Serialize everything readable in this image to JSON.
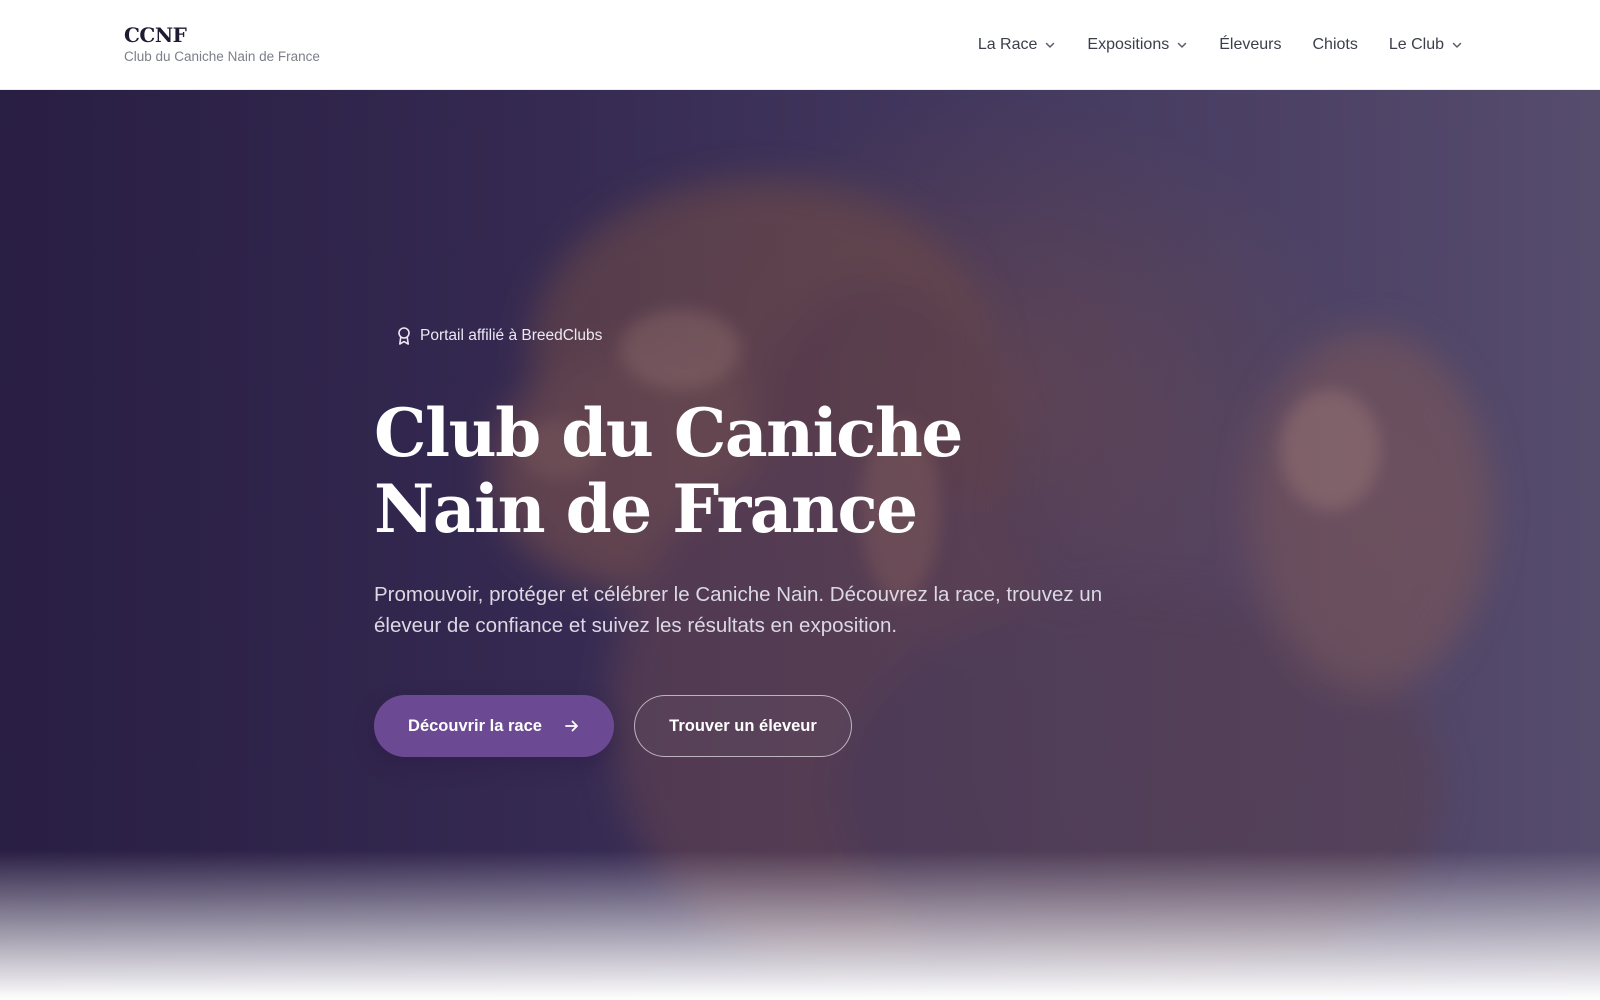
{
  "header": {
    "logo": "CCNF",
    "tagline": "Club du Caniche Nain de France",
    "nav": [
      {
        "label": "La Race",
        "has_dropdown": true
      },
      {
        "label": "Expositions",
        "has_dropdown": true
      },
      {
        "label": "Éleveurs",
        "has_dropdown": false
      },
      {
        "label": "Chiots",
        "has_dropdown": false
      },
      {
        "label": "Le Club",
        "has_dropdown": true
      }
    ]
  },
  "hero": {
    "badge_icon": "award-icon",
    "badge_text": "Portail affilié à BreedClubs",
    "title_line1": "Club du Caniche",
    "title_line2": "Nain de France",
    "subtitle": "Promouvoir, protéger et célébrer le Caniche Nain. Découvrez la race, trouvez un éleveur de confiance et suivez les résultats en exposition.",
    "primary_button": "Découvrir la race",
    "primary_button_icon": "arrow-right-icon",
    "secondary_button": "Trouver un éleveur",
    "background_image": "poodle-photo"
  },
  "colors": {
    "accent": "#6b4a93",
    "hero_tint": "#2a2040",
    "nav_text": "#3b3f4a"
  }
}
